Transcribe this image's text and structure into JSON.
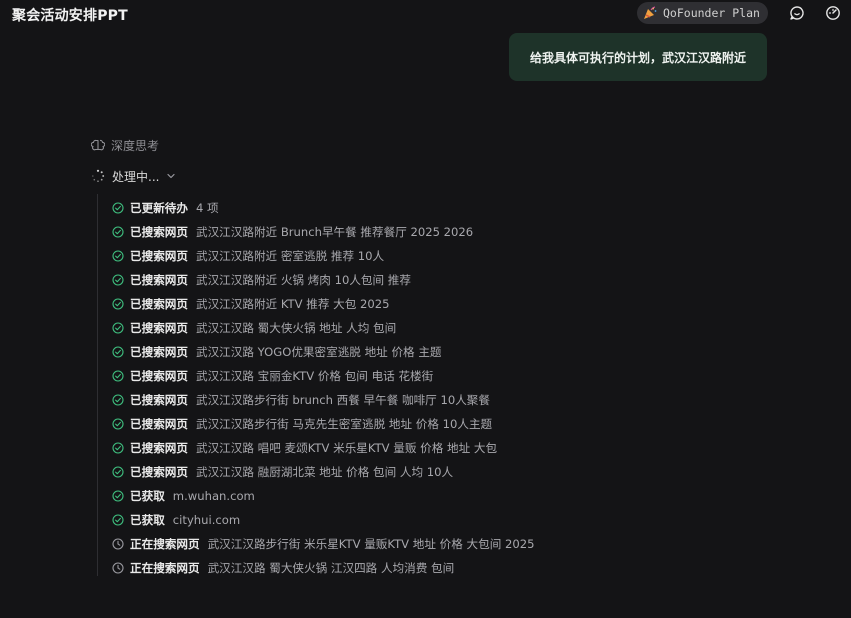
{
  "header": {
    "title": "聚会活动安排PPT",
    "plan_label": "QoFounder Plan"
  },
  "conversation": {
    "user_message": "给我具体可执行的计划，武汉江汉路附近"
  },
  "thinking": {
    "deep_think_label": "深度思考",
    "processing_label": "处理中..."
  },
  "steps": [
    {
      "status": "done",
      "action": "已更新待办",
      "detail": "4 项"
    },
    {
      "status": "done",
      "action": "已搜索网页",
      "detail": "武汉江汉路附近 Brunch早午餐 推荐餐厅 2025 2026"
    },
    {
      "status": "done",
      "action": "已搜索网页",
      "detail": "武汉江汉路附近 密室逃脱 推荐 10人"
    },
    {
      "status": "done",
      "action": "已搜索网页",
      "detail": "武汉江汉路附近 火锅 烤肉 10人包间 推荐"
    },
    {
      "status": "done",
      "action": "已搜索网页",
      "detail": "武汉江汉路附近 KTV 推荐 大包 2025"
    },
    {
      "status": "done",
      "action": "已搜索网页",
      "detail": "武汉江汉路 蜀大侠火锅 地址 人均 包间"
    },
    {
      "status": "done",
      "action": "已搜索网页",
      "detail": "武汉江汉路 YOGO优果密室逃脱 地址 价格 主题"
    },
    {
      "status": "done",
      "action": "已搜索网页",
      "detail": "武汉江汉路 宝丽金KTV 价格 包间 电话 花楼街"
    },
    {
      "status": "done",
      "action": "已搜索网页",
      "detail": "武汉江汉路步行街 brunch 西餐 早午餐 咖啡厅 10人聚餐"
    },
    {
      "status": "done",
      "action": "已搜索网页",
      "detail": "武汉江汉路步行街 马克先生密室逃脱 地址 价格 10人主题"
    },
    {
      "status": "done",
      "action": "已搜索网页",
      "detail": "武汉江汉路 唱吧 麦颂KTV 米乐星KTV 量贩 价格 地址 大包"
    },
    {
      "status": "done",
      "action": "已搜索网页",
      "detail": "武汉江汉路 融厨湖北菜 地址 价格 包间 人均 10人"
    },
    {
      "status": "done",
      "action": "已获取",
      "detail": "m.wuhan.com"
    },
    {
      "status": "done",
      "action": "已获取",
      "detail": "cityhui.com"
    },
    {
      "status": "pending",
      "action": "正在搜索网页",
      "detail": "武汉江汉路步行街 米乐星KTV 量贩KTV 地址 价格 大包间 2025"
    },
    {
      "status": "pending",
      "action": "正在搜索网页",
      "detail": "武汉江汉路 蜀大侠火锅 江汉四路 人均消费 包间"
    }
  ],
  "colors": {
    "background": "#141416",
    "user_bubble": "#1e3329",
    "done_icon": "#3fbf7f",
    "pending_icon": "#9a9aa0",
    "party_icon": "#f0a040"
  }
}
